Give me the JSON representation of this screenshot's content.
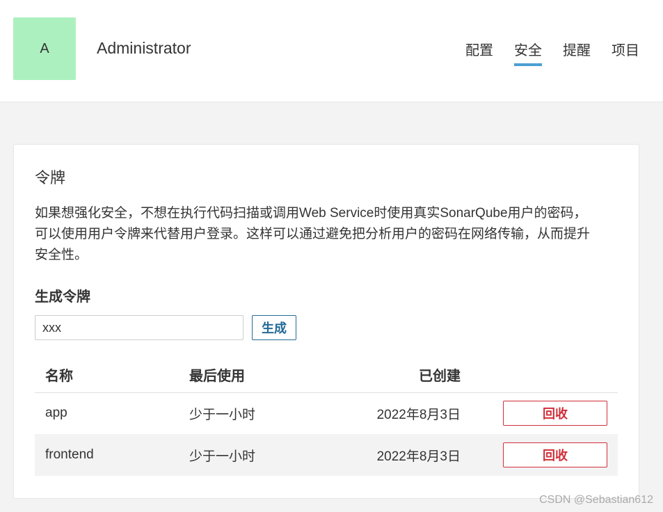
{
  "header": {
    "avatar_letter": "A",
    "username": "Administrator",
    "nav": [
      {
        "label": "配置",
        "active": false
      },
      {
        "label": "安全",
        "active": true
      },
      {
        "label": "提醒",
        "active": false
      },
      {
        "label": "项目",
        "active": false
      }
    ]
  },
  "tokens_card": {
    "title": "令牌",
    "description": "如果想强化安全，不想在执行代码扫描或调用Web Service时使用真实SonarQube用户的密码，可以使用用户令牌来代替用户登录。这样可以通过避免把分析用户的密码在网络传输，从而提升安全性。",
    "generate_section_title": "生成令牌",
    "token_name_value": "xxx",
    "generate_button": "生成",
    "table": {
      "headers": {
        "name": "名称",
        "last_used": "最后使用",
        "created": "已创建"
      },
      "rows": [
        {
          "name": "app",
          "last_used": "少于一小时",
          "created": "2022年8月3日",
          "action": "回收"
        },
        {
          "name": "frontend",
          "last_used": "少于一小时",
          "created": "2022年8月3日",
          "action": "回收"
        }
      ]
    }
  },
  "watermark": "CSDN @Sebastian612",
  "colors": {
    "avatar_bg": "#adf0c0",
    "nav_active_underline": "#4b9fd5",
    "primary_button": "#236a97",
    "danger_button": "#d02f3a",
    "page_bg": "#f3f3f3"
  }
}
